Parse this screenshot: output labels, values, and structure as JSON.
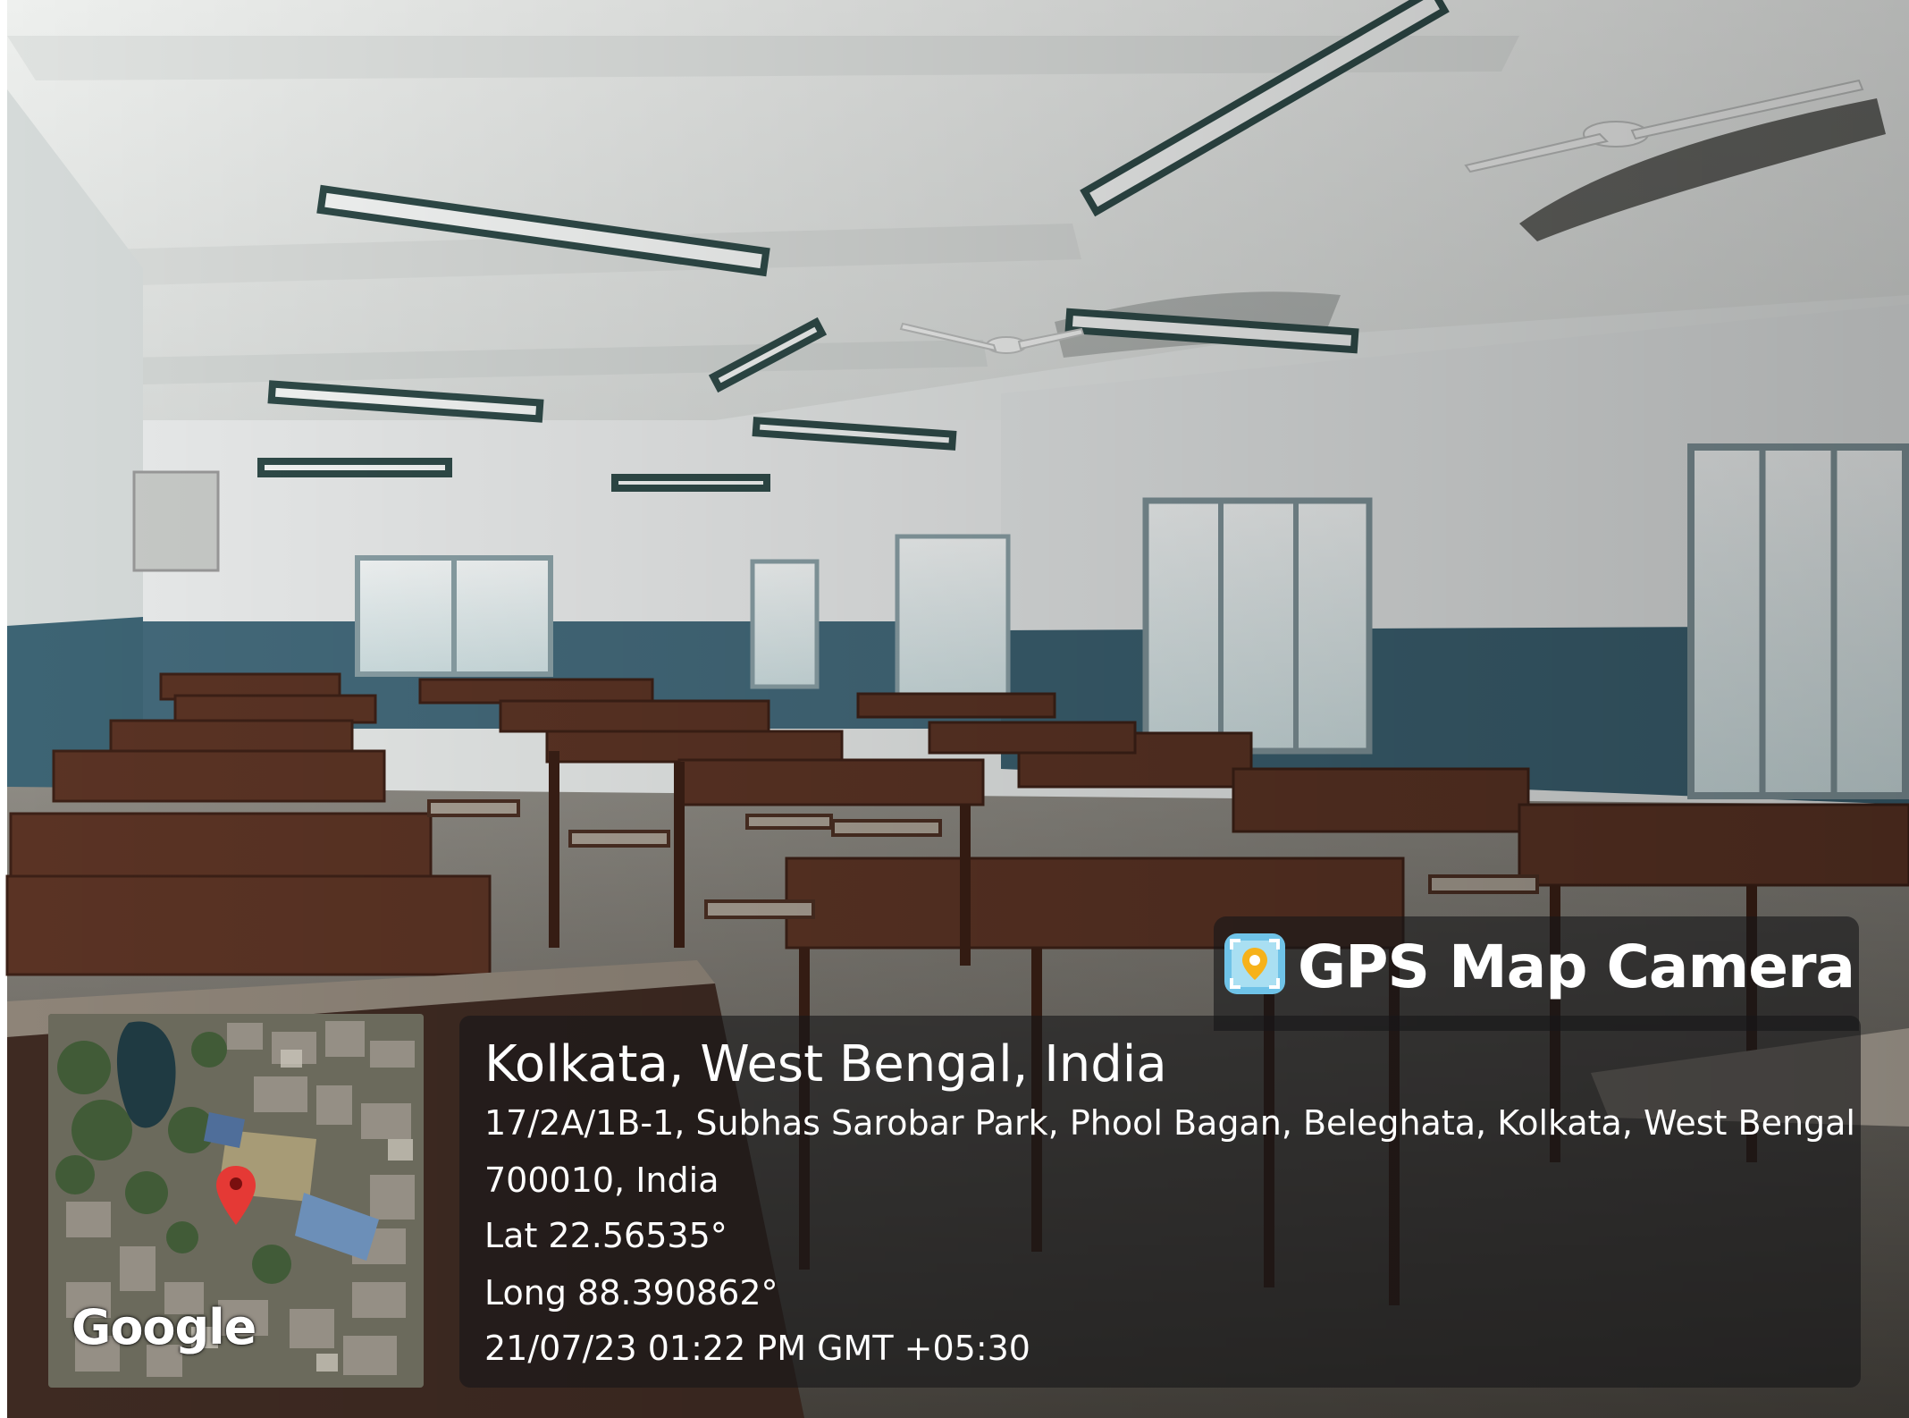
{
  "overlay": {
    "app_title": "GPS Map Camera",
    "app_icon": "map-camera-icon",
    "location_title": "Kolkata, West Bengal, India",
    "address_line_1": "17/2A/1B-1, Subhas Sarobar Park, Phool Bagan, Beleghata, Kolkata, West Bengal",
    "address_line_2": "700010, India",
    "latitude": "Lat 22.56535°",
    "longitude": "Long 88.390862°",
    "timestamp": "21/07/23 01:22 PM GMT +05:30"
  },
  "map": {
    "wordmark": "Google",
    "pin_icon": "map-pin-icon",
    "pin_color": "#e53935"
  },
  "colors": {
    "panel_background": "#161618",
    "text": "#ffffff",
    "wall_upper": "#e9ecec",
    "wall_lower": "#3f6572",
    "desk_wood": "#5a3324"
  }
}
